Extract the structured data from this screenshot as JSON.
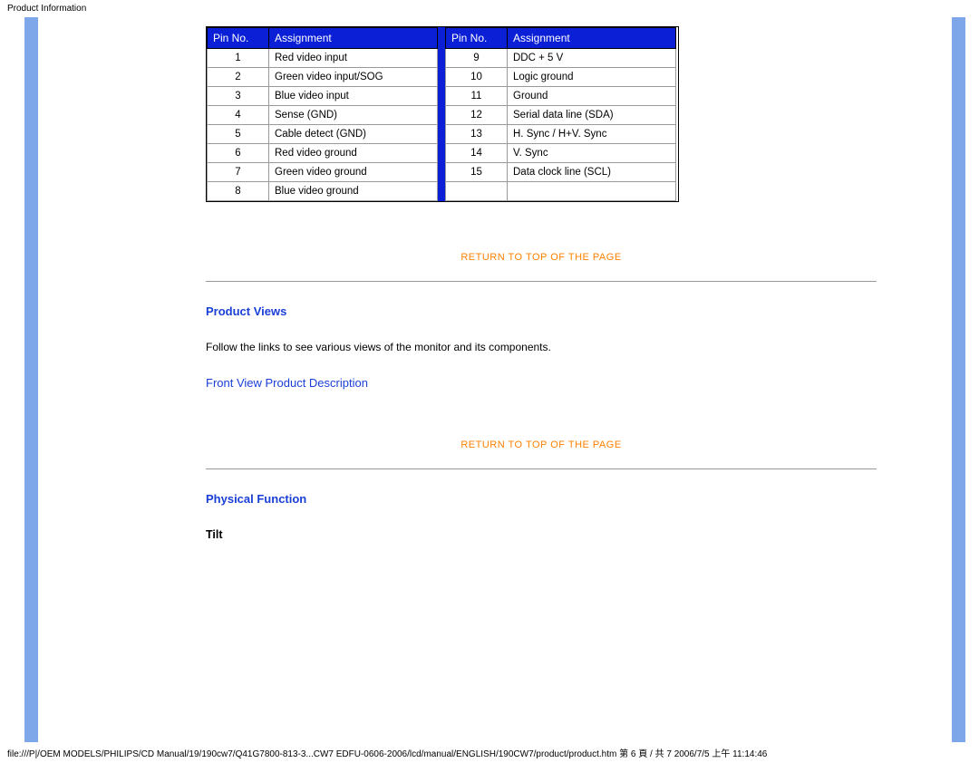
{
  "header": "Product Information",
  "table": {
    "headers": {
      "pin": "Pin No.",
      "assign": "Assignment"
    },
    "left": [
      {
        "pin": "1",
        "assign": "Red video input"
      },
      {
        "pin": "2",
        "assign": "Green video input/SOG"
      },
      {
        "pin": "3",
        "assign": "Blue video input"
      },
      {
        "pin": "4",
        "assign": "Sense (GND)"
      },
      {
        "pin": "5",
        "assign": "Cable detect (GND)"
      },
      {
        "pin": "6",
        "assign": "Red video ground"
      },
      {
        "pin": "7",
        "assign": "Green video ground"
      },
      {
        "pin": "8",
        "assign": "Blue video ground"
      }
    ],
    "right": [
      {
        "pin": "9",
        "assign": "DDC + 5 V"
      },
      {
        "pin": "10",
        "assign": "Logic ground"
      },
      {
        "pin": "11",
        "assign": "Ground"
      },
      {
        "pin": "12",
        "assign": "Serial data line (SDA)"
      },
      {
        "pin": "13",
        "assign": "H. Sync / H+V. Sync"
      },
      {
        "pin": "14",
        "assign": "V. Sync"
      },
      {
        "pin": "15",
        "assign": "Data clock line (SCL)"
      }
    ]
  },
  "links": {
    "return": "RETURN TO TOP OF THE PAGE",
    "front_view": "Front View Product Description"
  },
  "sections": {
    "product_views": "Product Views",
    "product_views_body": "Follow the links to see various views of the monitor and its components.",
    "physical_function": "Physical Function",
    "tilt": "Tilt"
  },
  "footer": "file:///P|/OEM MODELS/PHILIPS/CD Manual/19/190cw7/Q41G7800-813-3...CW7 EDFU-0606-2006/lcd/manual/ENGLISH/190CW7/product/product.htm 第 6 頁 / 共 7 2006/7/5 上午 11:14:46"
}
